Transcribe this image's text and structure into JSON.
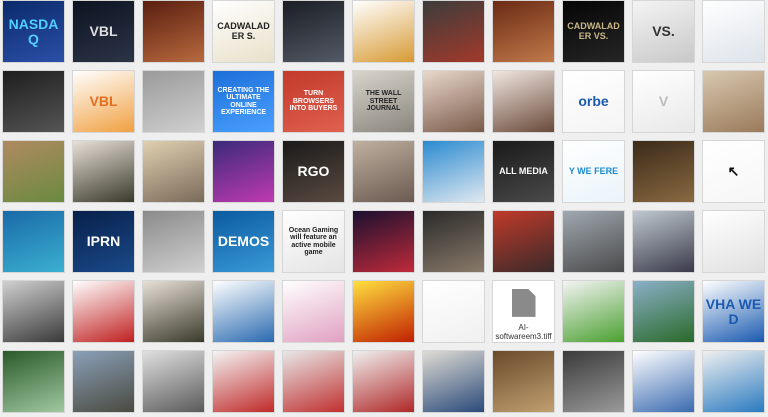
{
  "tiles": [
    {
      "c": [
        "#0a2a6a",
        "#2c4fa8"
      ],
      "t": "NASDAQ",
      "fc": "#4fd0ff"
    },
    {
      "c": [
        "#0d1320",
        "#2b3448"
      ],
      "t": "VBL",
      "fc": "#ddd"
    },
    {
      "c": [
        "#5a1e10",
        "#b86a3e"
      ],
      "t": "",
      "fc": "#fff"
    },
    {
      "c": [
        "#ffffff",
        "#e8e0c8"
      ],
      "t": "CADWALADER S.",
      "fc": "#222"
    },
    {
      "c": [
        "#1a1d24",
        "#545a66"
      ],
      "t": "",
      "fc": "#fff"
    },
    {
      "c": [
        "#ffffff",
        "#d79a34"
      ],
      "t": "",
      "fc": "#fff"
    },
    {
      "c": [
        "#3c3c3c",
        "#a33a2a"
      ],
      "t": "",
      "fc": "#fff"
    },
    {
      "c": [
        "#6a2a14",
        "#c27a4a"
      ],
      "t": "",
      "fc": "#fff"
    },
    {
      "c": [
        "#050505",
        "#262626"
      ],
      "t": "CADWALADER VS.",
      "fc": "#c9b78a"
    },
    {
      "c": [
        "#f4f4f4",
        "#c8c8c8"
      ],
      "t": "VS.",
      "fc": "#333"
    },
    {
      "c": [
        "#ffffff",
        "#dde3ea"
      ],
      "t": "",
      "fc": "#333"
    },
    {
      "c": [
        "#1e1e1e",
        "#555"
      ],
      "t": "",
      "fc": "#fff"
    },
    {
      "c": [
        "#ffffff",
        "#f0a040"
      ],
      "t": "VBL",
      "fc": "#e07020"
    },
    {
      "c": [
        "#9a9a9a",
        "#d0d0d0"
      ],
      "t": "",
      "fc": "#fff"
    },
    {
      "c": [
        "#1c6fd8",
        "#4aa0ff"
      ],
      "t": "CREATING THE ULTIMATE ONLINE EXPERIENCE",
      "fc": "#fff"
    },
    {
      "c": [
        "#c23a2a",
        "#e06050"
      ],
      "t": "TURN BROWSERS INTO BUYERS",
      "fc": "#fff"
    },
    {
      "c": [
        "#d8d4cc",
        "#8a867e"
      ],
      "t": "THE WALL STREET JOURNAL",
      "fc": "#222"
    },
    {
      "c": [
        "#e8d8cc",
        "#7a5a4a"
      ],
      "t": "",
      "fc": "#fff"
    },
    {
      "c": [
        "#f0e6e0",
        "#6a4a3a"
      ],
      "t": "",
      "fc": "#fff"
    },
    {
      "c": [
        "#ffffff",
        "#f4f4f4"
      ],
      "t": "orbe",
      "fc": "#1a5ab0"
    },
    {
      "c": [
        "#ffffff",
        "#e8e8e8"
      ],
      "t": "V",
      "fc": "#bbb"
    },
    {
      "c": [
        "#d8c8b0",
        "#9a7a5a"
      ],
      "t": "",
      "fc": "#fff"
    },
    {
      "c": [
        "#b08a60",
        "#6a8a40"
      ],
      "t": "",
      "fc": "#fff"
    },
    {
      "c": [
        "#e8e0d8",
        "#3a3a2a"
      ],
      "t": "",
      "fc": "#fff"
    },
    {
      "c": [
        "#e0d0b0",
        "#7a6a5a"
      ],
      "t": "",
      "fc": "#fff"
    },
    {
      "c": [
        "#3a2a7a",
        "#c03ab0"
      ],
      "t": "",
      "fc": "#fff"
    },
    {
      "c": [
        "#1a1a1a",
        "#5a4a40"
      ],
      "t": "RGO",
      "fc": "#fff"
    },
    {
      "c": [
        "#c0b0a0",
        "#6a5a50"
      ],
      "t": "",
      "fc": "#fff"
    },
    {
      "c": [
        "#2a8ad0",
        "#e0e8f0"
      ],
      "t": "",
      "fc": "#fff"
    },
    {
      "c": [
        "#1a1a1a",
        "#4a4a4a"
      ],
      "t": "ALL MEDIA",
      "fc": "#fff"
    },
    {
      "c": [
        "#ffffff",
        "#eaf4fa"
      ],
      "t": "Y WE FERE",
      "fc": "#1a8ad0"
    },
    {
      "c": [
        "#3a2a1a",
        "#8a6a40"
      ],
      "t": "",
      "fc": "#fff"
    },
    {
      "c": [
        "#ffffff",
        "#f6f6f6"
      ],
      "t": "↖",
      "fc": "#111"
    },
    {
      "c": [
        "#1a6aa8",
        "#3ab0d0"
      ],
      "t": "",
      "fc": "#fff"
    },
    {
      "c": [
        "#08204a",
        "#1a4a8a"
      ],
      "t": "IPRN",
      "fc": "#fff"
    },
    {
      "c": [
        "#8a8a8a",
        "#d0d0d0"
      ],
      "t": "",
      "fc": "#fff"
    },
    {
      "c": [
        "#0a5aa0",
        "#3a9ad8"
      ],
      "t": "DEMOS",
      "fc": "#fff"
    },
    {
      "c": [
        "#ffffff",
        "#e4e4e4"
      ],
      "t": "Ocean Gaming will feature an active mobile game",
      "fc": "#222"
    },
    {
      "c": [
        "#1a1030",
        "#c02a3a"
      ],
      "t": "",
      "fc": "#fff"
    },
    {
      "c": [
        "#2a2a2a",
        "#8a7a6a"
      ],
      "t": "",
      "fc": "#fff"
    },
    {
      "c": [
        "#c03a2a",
        "#3a2a2a"
      ],
      "t": "",
      "fc": "#fff"
    },
    {
      "c": [
        "#a0a8b0",
        "#4a4a4a"
      ],
      "t": "",
      "fc": "#fff"
    },
    {
      "c": [
        "#c0c8d0",
        "#3a3a4a"
      ],
      "t": "",
      "fc": "#fff"
    },
    {
      "c": [
        "#ffffff",
        "#e0e0e0"
      ],
      "t": "",
      "fc": "#333"
    },
    {
      "c": [
        "#d0d0d0",
        "#3a3a3a"
      ],
      "t": "",
      "fc": "#fff"
    },
    {
      "c": [
        "#ffffff",
        "#c02020"
      ],
      "t": "",
      "fc": "#fff"
    },
    {
      "c": [
        "#e8e0d8",
        "#3a3a2a"
      ],
      "t": "",
      "fc": "#fff"
    },
    {
      "c": [
        "#ffffff",
        "#2a6ab0"
      ],
      "t": "",
      "fc": "#fff"
    },
    {
      "c": [
        "#ffffff",
        "#e0a0c0"
      ],
      "t": "",
      "fc": "#fff"
    },
    {
      "c": [
        "#ffe040",
        "#c02000"
      ],
      "t": "",
      "fc": "#fff"
    },
    {
      "c": [
        "#ffffff",
        "#f0f0f0"
      ],
      "t": "",
      "fc": "#fff"
    },
    {
      "file": true,
      "name": "AI-softwareem3.tiff"
    },
    {
      "c": [
        "#f4f4f4",
        "#4aa030"
      ],
      "t": "",
      "fc": "#fff"
    },
    {
      "c": [
        "#8ab0c8",
        "#2a6a2a"
      ],
      "t": "",
      "fc": "#fff"
    },
    {
      "c": [
        "#ffffff",
        "#1a5ab0"
      ],
      "t": "VHA WE D",
      "fc": "#1a5ab0"
    },
    {
      "c": [
        "#2a5a2a",
        "#a0c8a0"
      ],
      "t": "",
      "fc": "#fff"
    },
    {
      "c": [
        "#8aa0b8",
        "#4a4a40"
      ],
      "t": "",
      "fc": "#fff"
    },
    {
      "c": [
        "#e0e0e0",
        "#5a5a5a"
      ],
      "t": "",
      "fc": "#fff"
    },
    {
      "c": [
        "#f4f4f4",
        "#c02a2a"
      ],
      "t": "",
      "fc": "#fff"
    },
    {
      "c": [
        "#e8e8e8",
        "#c03030"
      ],
      "t": "",
      "fc": "#fff"
    },
    {
      "c": [
        "#f0f0f0",
        "#b02828"
      ],
      "t": "",
      "fc": "#fff"
    },
    {
      "c": [
        "#e0dcd4",
        "#2a4a7a"
      ],
      "t": "",
      "fc": "#fff"
    },
    {
      "c": [
        "#6a4a2a",
        "#c0a070"
      ],
      "t": "",
      "fc": "#fff"
    },
    {
      "c": [
        "#3a3a3a",
        "#9a9a9a"
      ],
      "t": "",
      "fc": "#fff"
    },
    {
      "c": [
        "#ffffff",
        "#3a6ab0"
      ],
      "t": "",
      "fc": "#fff"
    },
    {
      "c": [
        "#f0f0f0",
        "#2a7ac0"
      ],
      "t": "",
      "fc": "#fff"
    }
  ]
}
